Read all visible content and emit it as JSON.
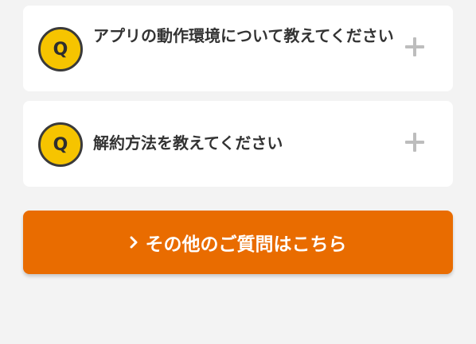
{
  "faq": {
    "badge_letter": "Q",
    "items": [
      {
        "question": "アプリの動作環境について教えてください",
        "expand_icon": "plus-icon"
      },
      {
        "question": "解約方法を教えてください",
        "expand_icon": "plus-icon"
      }
    ]
  },
  "cta": {
    "label": "その他のご質問はこちら",
    "icon": "chevron-right-icon"
  },
  "colors": {
    "background": "#f3f3f3",
    "card": "#ffffff",
    "badge": "#f6c400",
    "badge_border": "#3a3a3a",
    "text": "#333333",
    "plus": "#bdbdbd",
    "cta": "#e96c00"
  }
}
